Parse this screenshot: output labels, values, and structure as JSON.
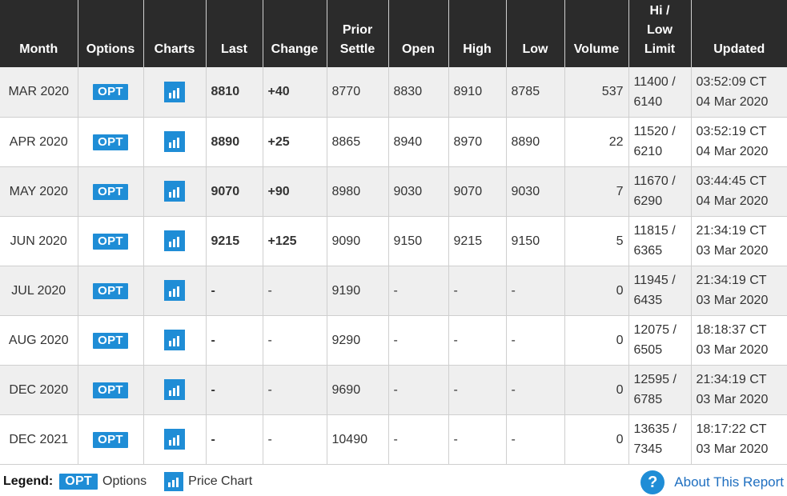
{
  "headers": {
    "month": "Month",
    "options": "Options",
    "charts": "Charts",
    "last": "Last",
    "change": "Change",
    "prior_settle_1": "Prior",
    "prior_settle_2": "Settle",
    "open": "Open",
    "high": "High",
    "low": "Low",
    "volume": "Volume",
    "limit_1": "Hi /",
    "limit_2": "Low",
    "limit_3": "Limit",
    "updated": "Updated"
  },
  "rows": [
    {
      "month": "MAR 2020",
      "opt": "OPT",
      "last": "8810",
      "change": "+40",
      "prior": "8770",
      "open": "8830",
      "high": "8910",
      "low": "8785",
      "volume": "537",
      "hi": "11400 /",
      "lo": "6140",
      "time": "03:52:09 CT",
      "date": "04 Mar 2020"
    },
    {
      "month": "APR 2020",
      "opt": "OPT",
      "last": "8890",
      "change": "+25",
      "prior": "8865",
      "open": "8940",
      "high": "8970",
      "low": "8890",
      "volume": "22",
      "hi": "11520 /",
      "lo": "6210",
      "time": "03:52:19 CT",
      "date": "04 Mar 2020"
    },
    {
      "month": "MAY 2020",
      "opt": "OPT",
      "last": "9070",
      "change": "+90",
      "prior": "8980",
      "open": "9030",
      "high": "9070",
      "low": "9030",
      "volume": "7",
      "hi": "11670 /",
      "lo": "6290",
      "time": "03:44:45 CT",
      "date": "04 Mar 2020"
    },
    {
      "month": "JUN 2020",
      "opt": "OPT",
      "last": "9215",
      "change": "+125",
      "prior": "9090",
      "open": "9150",
      "high": "9215",
      "low": "9150",
      "volume": "5",
      "hi": "11815 /",
      "lo": "6365",
      "time": "21:34:19 CT",
      "date": "03 Mar 2020"
    },
    {
      "month": "JUL 2020",
      "opt": "OPT",
      "last": "-",
      "change": "-",
      "prior": "9190",
      "open": "-",
      "high": "-",
      "low": "-",
      "volume": "0",
      "hi": "11945 /",
      "lo": "6435",
      "time": "21:34:19 CT",
      "date": "03 Mar 2020"
    },
    {
      "month": "AUG 2020",
      "opt": "OPT",
      "last": "-",
      "change": "-",
      "prior": "9290",
      "open": "-",
      "high": "-",
      "low": "-",
      "volume": "0",
      "hi": "12075 /",
      "lo": "6505",
      "time": "18:18:37 CT",
      "date": "03 Mar 2020"
    },
    {
      "month": "DEC 2020",
      "opt": "OPT",
      "last": "-",
      "change": "-",
      "prior": "9690",
      "open": "-",
      "high": "-",
      "low": "-",
      "volume": "0",
      "hi": "12595 /",
      "lo": "6785",
      "time": "21:34:19 CT",
      "date": "03 Mar 2020"
    },
    {
      "month": "DEC 2021",
      "opt": "OPT",
      "last": "-",
      "change": "-",
      "prior": "10490",
      "open": "-",
      "high": "-",
      "low": "-",
      "volume": "0",
      "hi": "13635 /",
      "lo": "7345",
      "time": "18:17:22 CT",
      "date": "03 Mar 2020"
    }
  ],
  "legend": {
    "label": "Legend:",
    "opt_badge": "OPT",
    "options_text": "Options",
    "chart_text": "Price Chart"
  },
  "about": {
    "icon_glyph": "?",
    "link_text": "About This Report"
  },
  "colors": {
    "header_bg": "#2b2b2b",
    "accent_blue": "#1f8dd6",
    "positive_green": "#1a8c1a",
    "row_alt": "#efefef"
  },
  "icons": {
    "options": "opt-badge",
    "charts": "bar-chart-icon",
    "help": "question-circle-icon"
  }
}
